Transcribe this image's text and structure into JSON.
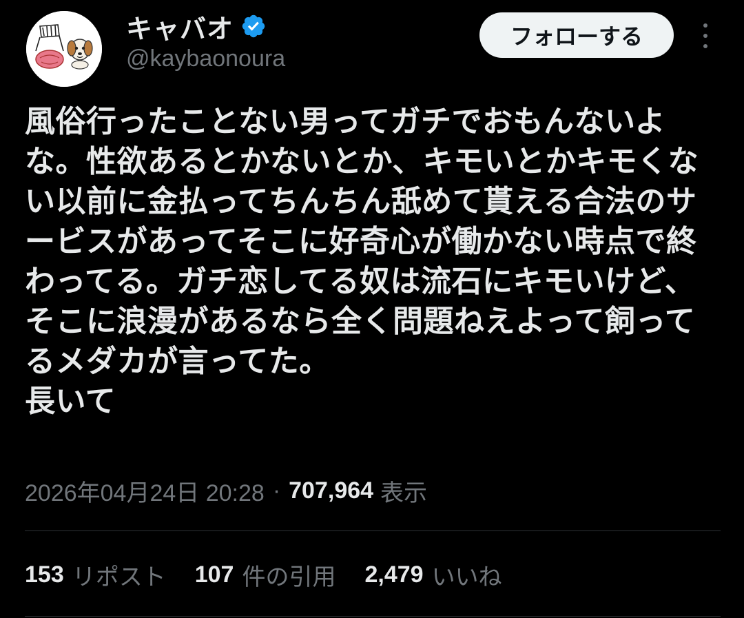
{
  "colors": {
    "background": "#000000",
    "text_primary": "#e7e9ea",
    "text_secondary": "#71767b",
    "verified_badge": "#1d9bf0",
    "follow_button_bg": "#eff3f4",
    "divider": "#2f3336"
  },
  "author": {
    "display_name": "キャバオ",
    "handle": "@kaybaonoura",
    "verified": true,
    "avatar_icon": "cartoon-avatar-icon"
  },
  "header": {
    "follow_label": "フォローする",
    "more_icon": "more-vertical-icon"
  },
  "tweet": {
    "text": "風俗行ったことない男ってガチでおもんないよな。性欲あるとかないとか、キモいとかキモくない以前に金払ってちんちん舐めて貰える合法のサービスがあってそこに好奇心が働かない時点で終わってる。ガチ恋してる奴は流石にキモいけど、そこに浪漫があるなら全く問題ねえよって飼ってるメダカが言ってた。\n長いて",
    "timestamp": "2026年04月24日 20:28",
    "separator": "·",
    "views_count": "707,964",
    "views_label": "表示"
  },
  "stats": [
    {
      "count": "153",
      "label": "リポスト"
    },
    {
      "count": "107",
      "label": "件の引用"
    },
    {
      "count": "2,479",
      "label": "いいね"
    }
  ]
}
